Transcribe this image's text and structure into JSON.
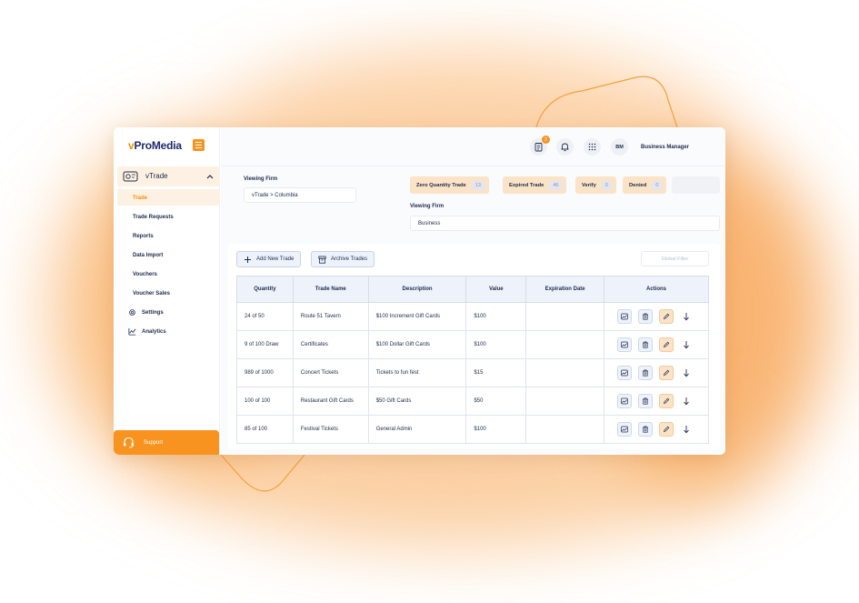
{
  "brand": {
    "name_prefix": "v",
    "name_rest": "ProMedia"
  },
  "sidebar": {
    "parent": {
      "label": "vTrade"
    },
    "items": [
      {
        "label": "Trade",
        "active": true
      },
      {
        "label": "Trade Requests"
      },
      {
        "label": "Reports"
      },
      {
        "label": "Data Import"
      },
      {
        "label": "Vouchers"
      },
      {
        "label": "Voucher Sales"
      }
    ],
    "settings_label": "Settings",
    "analytics_label": "Analytics",
    "support_label": "Support"
  },
  "topbar": {
    "notification_count": "2",
    "avatar_initials": "BM",
    "user_name": "Business Manager"
  },
  "filters": {
    "viewing_firm_label": "Viewing Firm",
    "viewing_firm_value": "vTrade > Columbia",
    "viewing_firm2_label": "Viewing Firm",
    "viewing_firm2_value": "Business",
    "chips": [
      {
        "label": "Zero Quantity Trade",
        "count": "13"
      },
      {
        "label": "Expired Trade",
        "count": "46"
      },
      {
        "label": "Verify",
        "count": "0"
      },
      {
        "label": "Denied",
        "count": "0"
      }
    ]
  },
  "toolbar": {
    "add_label": "Add New Trade",
    "archive_label": "Archive Trades",
    "filter_placeholder": "Global Filter"
  },
  "table": {
    "headers": [
      "Quantity",
      "Trade Name",
      "Description",
      "Value",
      "Expiration Date",
      "Actions"
    ],
    "rows": [
      {
        "quantity": "24 of 50",
        "name": "Route 51 Tavern",
        "description": "$100 Increment Gift Cards",
        "value": "$100",
        "expiration": ""
      },
      {
        "quantity": "9 of 100 Draw",
        "name": "Certificates",
        "description": "$100 Dollar Gift Cards",
        "value": "$100",
        "expiration": ""
      },
      {
        "quantity": "989 of 1000",
        "name": "Concert Tickets",
        "description": "Tickets to fun fest",
        "value": "$15",
        "expiration": ""
      },
      {
        "quantity": "100 of 100",
        "name": "Restaurant Gift Cards",
        "description": "$50 Gift Cards",
        "value": "$50",
        "expiration": ""
      },
      {
        "quantity": "85 of 100",
        "name": "Festival Tickets",
        "description": "General Admin",
        "value": "$100",
        "expiration": ""
      }
    ]
  },
  "colors": {
    "accent": "#f7931e",
    "navy": "#1e2a4a",
    "chip": "#fbe3c8",
    "header_bg": "#eef3fb"
  }
}
